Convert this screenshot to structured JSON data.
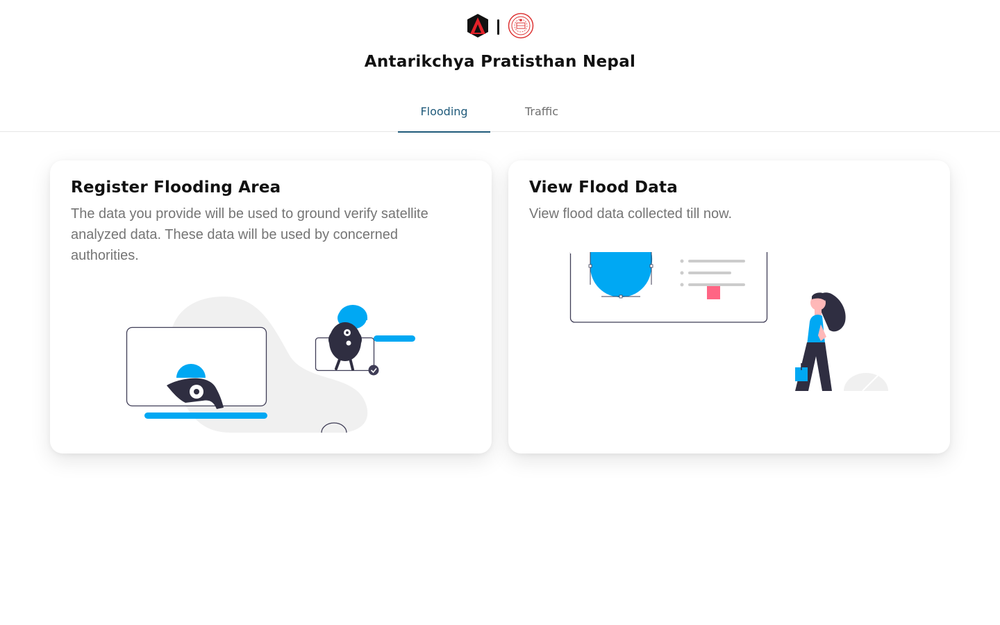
{
  "header": {
    "org_name": "Antarikchya Pratisthan Nepal",
    "logos": [
      "org-logo-icon",
      "government-seal-icon"
    ]
  },
  "tabs": [
    {
      "label": "Flooding",
      "active": true
    },
    {
      "label": "Traffic",
      "active": false
    }
  ],
  "cards": [
    {
      "title": "Register Flooding Area",
      "description": "The data you provide will be used to ground verify satellite analyzed data. These data will be used by concerned authorities.",
      "illustration": "data-entry-illustration"
    },
    {
      "title": "View Flood Data",
      "description": "View flood data collected till now.",
      "illustration": "dashboard-viewing-illustration"
    }
  ],
  "colors": {
    "accent": "#00a8f3",
    "tab_active": "#1f5a7a",
    "dark_figure": "#2f2e41",
    "pink": "#ff6584",
    "logo_red": "#e2222a"
  }
}
